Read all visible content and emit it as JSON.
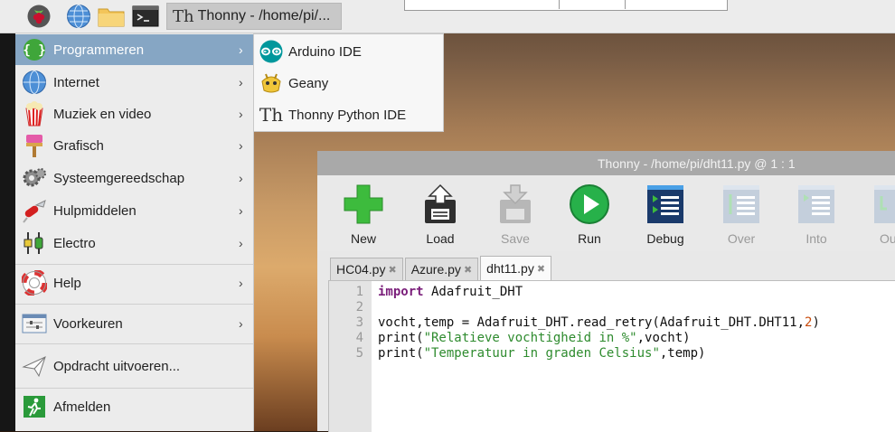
{
  "panel": {
    "task_title": "Thonny - /home/pi/..."
  },
  "main_menu": {
    "items": [
      {
        "label": "Programmeren",
        "icon": "programming-icon",
        "arrow": "›"
      },
      {
        "label": "Internet",
        "icon": "globe-icon",
        "arrow": "›"
      },
      {
        "label": "Muziek en video",
        "icon": "popcorn-icon",
        "arrow": "›"
      },
      {
        "label": "Grafisch",
        "icon": "paintbrush-icon",
        "arrow": "›"
      },
      {
        "label": "Systeemgereedschap",
        "icon": "gears-icon",
        "arrow": "›"
      },
      {
        "label": "Hulpmiddelen",
        "icon": "swiss-knife-icon",
        "arrow": "›"
      },
      {
        "label": "Electro",
        "icon": "electronics-icon",
        "arrow": "›"
      },
      {
        "label": "Help",
        "icon": "lifebuoy-icon",
        "arrow": "›"
      },
      {
        "label": "Voorkeuren",
        "icon": "preferences-icon",
        "arrow": "›"
      },
      {
        "label": "Opdracht uitvoeren...",
        "icon": "run-command-icon"
      },
      {
        "label": "Afmelden",
        "icon": "logout-icon"
      }
    ]
  },
  "submenu": {
    "items": [
      {
        "label": "Arduino IDE",
        "icon": "arduino-icon"
      },
      {
        "label": "Geany",
        "icon": "geany-icon"
      },
      {
        "label": "Thonny Python IDE",
        "icon": "thonny-icon"
      }
    ]
  },
  "thonny": {
    "title": "Thonny  -  /home/pi/dht11.py  @  1 : 1",
    "toolbar": [
      {
        "label": "New",
        "icon": "new-file-icon",
        "enabled": true
      },
      {
        "label": "Load",
        "icon": "load-icon",
        "enabled": true
      },
      {
        "label": "Save",
        "icon": "save-icon",
        "enabled": false
      },
      {
        "label": "Run",
        "icon": "run-icon",
        "enabled": true
      },
      {
        "label": "Debug",
        "icon": "debug-icon",
        "enabled": true
      },
      {
        "label": "Over",
        "icon": "step-over-icon",
        "enabled": false
      },
      {
        "label": "Into",
        "icon": "step-into-icon",
        "enabled": false
      },
      {
        "label": "Ou",
        "icon": "step-out-icon",
        "enabled": false
      }
    ],
    "tabs": [
      {
        "label": "HC04.py",
        "close": "✖"
      },
      {
        "label": "Azure.py",
        "close": "✖"
      },
      {
        "label": "dht11.py",
        "close": "✖",
        "active": true
      }
    ],
    "line_numbers": [
      "1",
      "2",
      "3",
      "4",
      "5"
    ],
    "code": {
      "l1_kw": "import",
      "l1_rest": " Adafruit_DHT",
      "l3_a": "vocht,temp = Adafruit_DHT.read_retry(Adafruit_DHT.DHT11,",
      "l3_num": "2",
      "l3_b": ")",
      "l4_a": "print(",
      "l4_str": "\"Relatieve vochtigheid in %\"",
      "l4_b": ",vocht)",
      "l5_a": "print(",
      "l5_str": "\"Temperatuur in graden Celsius\"",
      "l5_b": ",temp)"
    }
  }
}
